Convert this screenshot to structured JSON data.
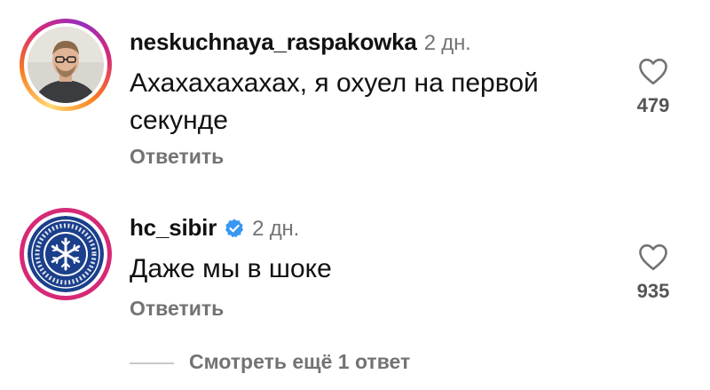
{
  "comments": [
    {
      "username": "neskuchnaya_raspakowka",
      "time": "2 дн.",
      "text": "Ахахахахахах, я охуел на первой секунде",
      "reply_label": "Ответить",
      "likes": "479",
      "verified": false
    },
    {
      "username": "hc_sibir",
      "time": "2 дн.",
      "text": "Даже мы в шоке",
      "reply_label": "Ответить",
      "likes": "935",
      "verified": true
    }
  ],
  "view_more_label": "Смотреть ещё 1 ответ",
  "colors": {
    "verified_badge": "#3897f0",
    "secondary_text": "#737373",
    "logo_navy": "#1b3f8b"
  }
}
